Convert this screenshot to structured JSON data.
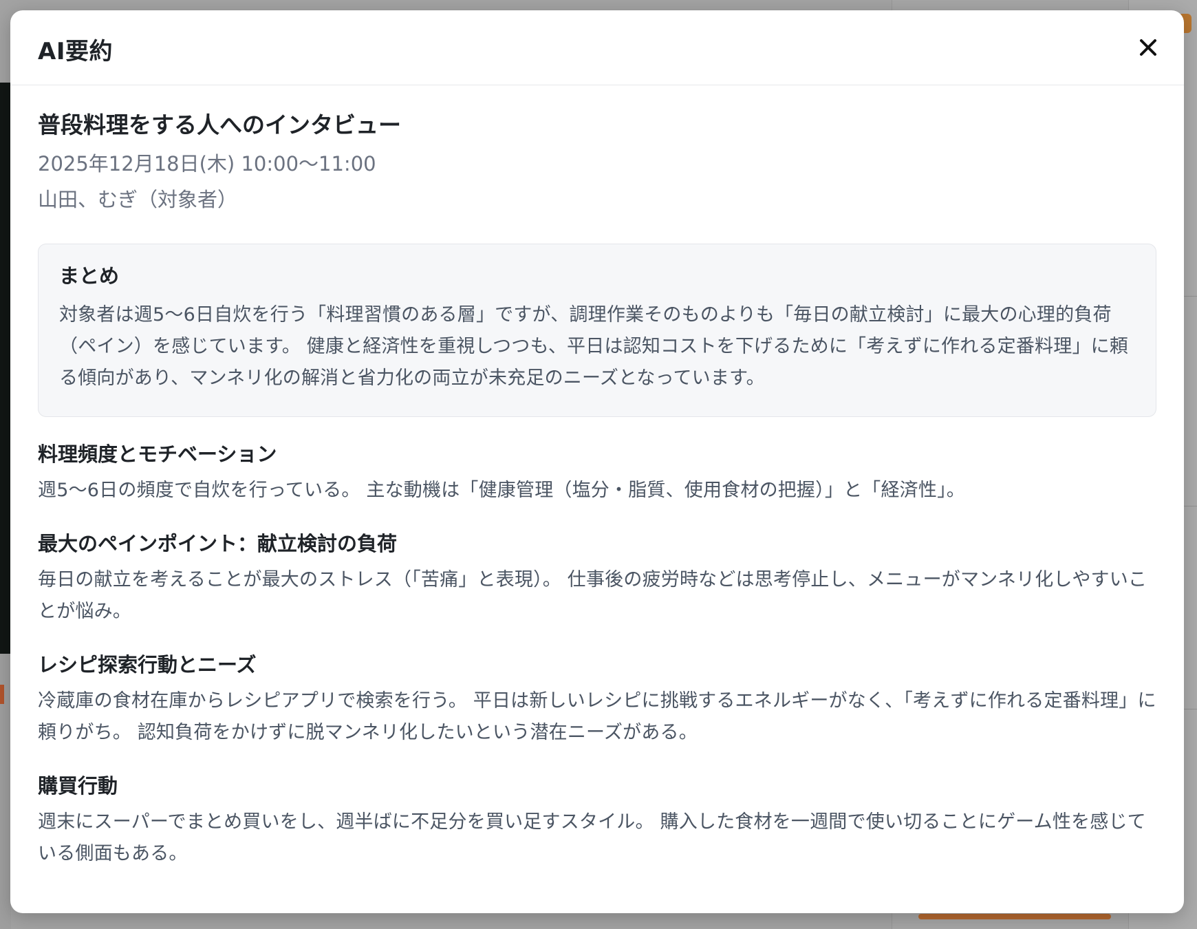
{
  "modal": {
    "title": "AI要約",
    "close_icon": "close-icon"
  },
  "interview": {
    "title": "普段料理をする人へのインタビュー",
    "datetime": "2025年12月18日(木) 10:00〜11:00",
    "participants": "山田、むぎ（対象者）"
  },
  "summary": {
    "heading": "まとめ",
    "text": "対象者は週5〜6日自炊を行う「料理習慣のある層」ですが、調理作業そのものよりも「毎日の献立検討」に最大の心理的負荷（ペイン）を感じています。 健康と経済性を重視しつつも、平日は認知コストを下げるために「考えずに作れる定番料理」に頼る傾向があり、マンネリ化の解消と省力化の両立が未充足のニーズとなっています。"
  },
  "sections": [
    {
      "heading": "料理頻度とモチベーション",
      "text": "週5〜6日の頻度で自炊を行っている。 主な動機は「健康管理（塩分・脂質、使用食材の把握）」と「経済性」。"
    },
    {
      "heading": "最大のペインポイント：献立検討の負荷",
      "text": "毎日の献立を考えることが最大のストレス（「苦痛」と表現）。 仕事後の疲労時などは思考停止し、メニューがマンネリ化しやすいことが悩み。"
    },
    {
      "heading": "レシピ探索行動とニーズ",
      "text": "冷蔵庫の食材在庫からレシピアプリで検索を行う。 平日は新しいレシピに挑戦するエネルギーがなく、「考えずに作れる定番料理」に頼りがち。 認知負荷をかけずに脱マンネリ化したいという潜在ニーズがある。"
    },
    {
      "heading": "購買行動",
      "text": "週末にスーパーでまとめ買いをし、週半ばに不足分を買い足すスタイル。 購入した食材を一週間で使い切ることにゲーム性を感じている側面もある。"
    }
  ]
}
